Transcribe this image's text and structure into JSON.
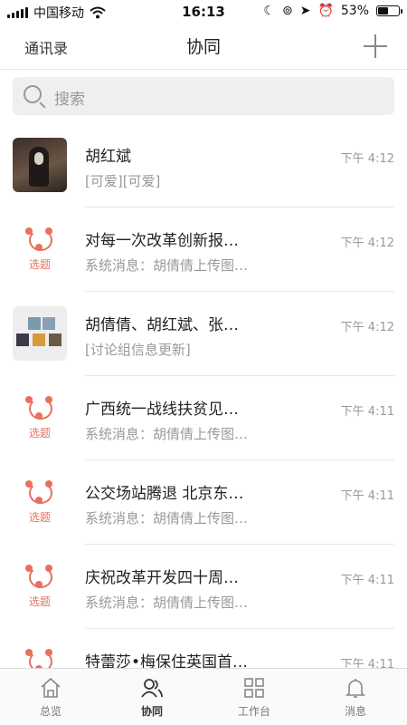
{
  "status_bar": {
    "carrier": "中国移动",
    "time": "16:13",
    "battery": "53%",
    "battery_level": 0.53
  },
  "nav": {
    "left_label": "通讯录",
    "title": "协同"
  },
  "search": {
    "placeholder": "搜索"
  },
  "topic_badge": "选题",
  "conversations": [
    {
      "title": "胡红斌",
      "subtitle": "[可爱][可爱]",
      "time": "下午 4:12",
      "avatar": "photo"
    },
    {
      "title": "对每一次改革创新报…",
      "subtitle": "系统消息：胡倩倩上传图…",
      "time": "下午 4:12",
      "avatar": "topic"
    },
    {
      "title": "胡倩倩、胡红斌、张…",
      "subtitle": "[讨论组信息更新]",
      "time": "下午 4:12",
      "avatar": "group"
    },
    {
      "title": "广西统一战线扶贫见…",
      "subtitle": "系统消息：胡倩倩上传图…",
      "time": "下午 4:11",
      "avatar": "topic"
    },
    {
      "title": "公交场站腾退 北京东…",
      "subtitle": "系统消息：胡倩倩上传图…",
      "time": "下午 4:11",
      "avatar": "topic"
    },
    {
      "title": "庆祝改革开发四十周…",
      "subtitle": "系统消息：胡倩倩上传图…",
      "time": "下午 4:11",
      "avatar": "topic"
    },
    {
      "title": "特蕾莎•梅保住英国首…",
      "subtitle": "",
      "time": "下午 4:11",
      "avatar": "topic"
    }
  ],
  "tabbar": {
    "tabs": [
      {
        "label": "总览",
        "icon": "home-icon"
      },
      {
        "label": "协同",
        "icon": "people-icon",
        "active": true
      },
      {
        "label": "工作台",
        "icon": "grid-icon"
      },
      {
        "label": "消息",
        "icon": "bell-icon"
      }
    ]
  },
  "colors": {
    "accent": "#e8705c",
    "muted": "#999999"
  }
}
